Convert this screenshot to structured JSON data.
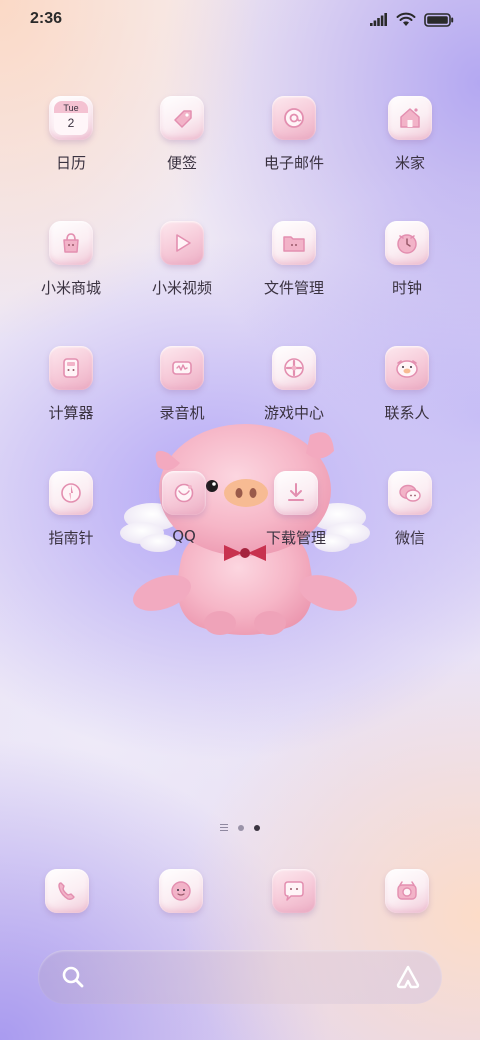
{
  "status_bar": {
    "time": "2:36",
    "icons": [
      "signal-icon",
      "wifi-icon",
      "battery-icon"
    ]
  },
  "calendar": {
    "weekday": "Tue",
    "day": "2"
  },
  "apps": [
    {
      "label": "日历",
      "icon": "calendar-icon"
    },
    {
      "label": "便签",
      "icon": "notes-icon"
    },
    {
      "label": "电子邮件",
      "icon": "email-icon"
    },
    {
      "label": "米家",
      "icon": "home-icon"
    },
    {
      "label": "小米商城",
      "icon": "shopping-bag-icon"
    },
    {
      "label": "小米视频",
      "icon": "play-icon"
    },
    {
      "label": "文件管理",
      "icon": "folder-icon"
    },
    {
      "label": "时钟",
      "icon": "clock-icon"
    },
    {
      "label": "计算器",
      "icon": "calculator-icon"
    },
    {
      "label": "录音机",
      "icon": "recorder-icon"
    },
    {
      "label": "游戏中心",
      "icon": "gamepad-icon"
    },
    {
      "label": "联系人",
      "icon": "contacts-icon"
    },
    {
      "label": "指南针",
      "icon": "compass-icon"
    },
    {
      "label": "QQ",
      "icon": "qq-icon"
    },
    {
      "label": "下载管理",
      "icon": "download-icon"
    },
    {
      "label": "微信",
      "icon": "wechat-icon"
    }
  ],
  "dock": [
    {
      "icon": "phone-icon"
    },
    {
      "icon": "messages-icon"
    },
    {
      "icon": "chat-bubble-icon"
    },
    {
      "icon": "camera-icon"
    }
  ],
  "page_indicator": {
    "pages": 3,
    "active": 3
  },
  "search": {
    "icon": "search-icon",
    "assistant_icon": "assistant-icon"
  },
  "colors": {
    "tile_light": "#fbeef3",
    "tile_pink": "#f1c9d8",
    "glyph_pink": "#e38fb0",
    "pig_body": "#f6b8c8",
    "bow_tie": "#c8324f"
  }
}
